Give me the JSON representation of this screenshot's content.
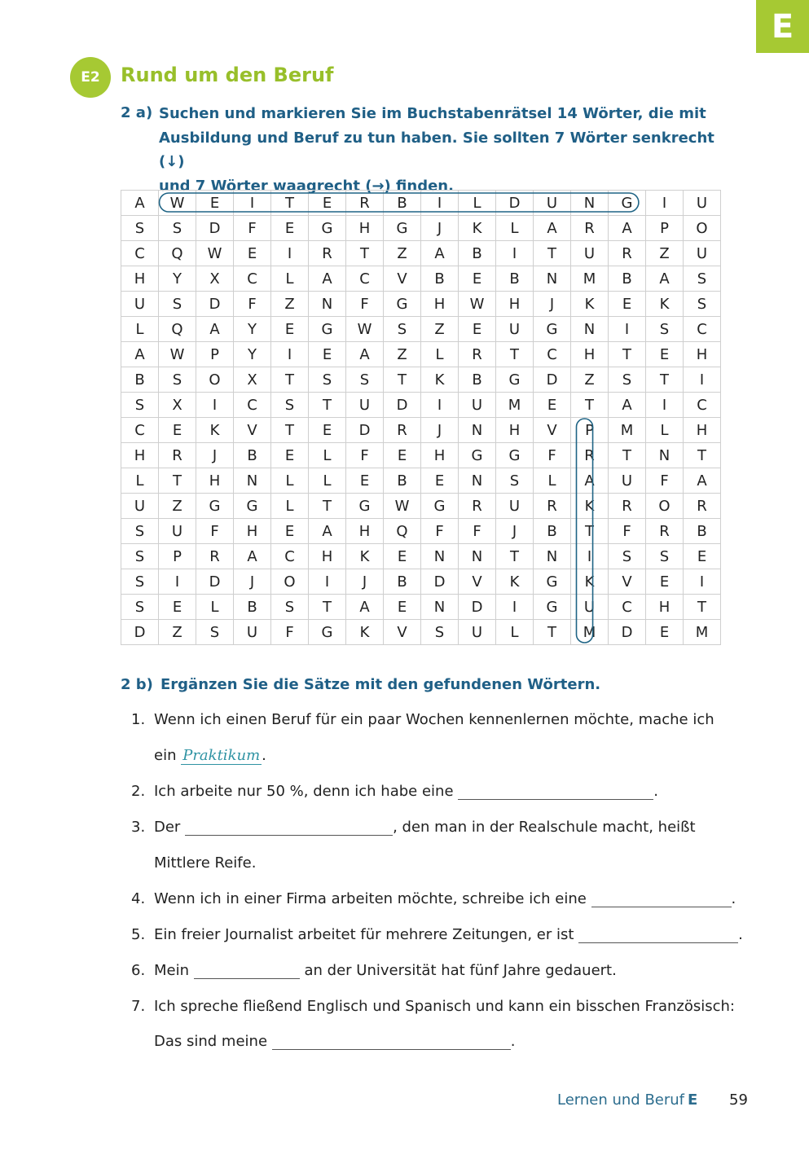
{
  "chapter_tab": "E",
  "section": {
    "badge": "E2",
    "title": "Rund um den Beruf"
  },
  "task_a": {
    "label": "2 a)",
    "lines": [
      "Suchen und markieren Sie im Buchstabenrätsel 14 Wörter, die mit",
      "Ausbildung und Beruf zu tun haben. Sie sollten 7 Wörter senkrecht (↓)",
      "und 7 Wörter waagrecht (→) finden."
    ]
  },
  "grid": {
    "rows": [
      [
        "A",
        "W",
        "E",
        "I",
        "T",
        "E",
        "R",
        "B",
        "I",
        "L",
        "D",
        "U",
        "N",
        "G",
        "I",
        "U"
      ],
      [
        "S",
        "S",
        "D",
        "F",
        "E",
        "G",
        "H",
        "G",
        "J",
        "K",
        "L",
        "A",
        "R",
        "A",
        "P",
        "O"
      ],
      [
        "C",
        "Q",
        "W",
        "E",
        "I",
        "R",
        "T",
        "Z",
        "A",
        "B",
        "I",
        "T",
        "U",
        "R",
        "Z",
        "U"
      ],
      [
        "H",
        "Y",
        "X",
        "C",
        "L",
        "A",
        "C",
        "V",
        "B",
        "E",
        "B",
        "N",
        "M",
        "B",
        "A",
        "S"
      ],
      [
        "U",
        "S",
        "D",
        "F",
        "Z",
        "N",
        "F",
        "G",
        "H",
        "W",
        "H",
        "J",
        "K",
        "E",
        "K",
        "S"
      ],
      [
        "L",
        "Q",
        "A",
        "Y",
        "E",
        "G",
        "W",
        "S",
        "Z",
        "E",
        "U",
        "G",
        "N",
        "I",
        "S",
        "C"
      ],
      [
        "A",
        "W",
        "P",
        "Y",
        "I",
        "E",
        "A",
        "Z",
        "L",
        "R",
        "T",
        "C",
        "H",
        "T",
        "E",
        "H"
      ],
      [
        "B",
        "S",
        "O",
        "X",
        "T",
        "S",
        "S",
        "T",
        "K",
        "B",
        "G",
        "D",
        "Z",
        "S",
        "T",
        "I"
      ],
      [
        "S",
        "X",
        "I",
        "C",
        "S",
        "T",
        "U",
        "D",
        "I",
        "U",
        "M",
        "E",
        "T",
        "A",
        "I",
        "C"
      ],
      [
        "C",
        "E",
        "K",
        "V",
        "T",
        "E",
        "D",
        "R",
        "J",
        "N",
        "H",
        "V",
        "P",
        "M",
        "L",
        "H"
      ],
      [
        "H",
        "R",
        "J",
        "B",
        "E",
        "L",
        "F",
        "E",
        "H",
        "G",
        "G",
        "F",
        "R",
        "T",
        "N",
        "T"
      ],
      [
        "L",
        "T",
        "H",
        "N",
        "L",
        "L",
        "E",
        "B",
        "E",
        "N",
        "S",
        "L",
        "A",
        "U",
        "F",
        "A"
      ],
      [
        "U",
        "Z",
        "G",
        "G",
        "L",
        "T",
        "G",
        "W",
        "G",
        "R",
        "U",
        "R",
        "K",
        "R",
        "O",
        "R"
      ],
      [
        "S",
        "U",
        "F",
        "H",
        "E",
        "A",
        "H",
        "Q",
        "F",
        "F",
        "J",
        "B",
        "T",
        "F",
        "R",
        "B"
      ],
      [
        "S",
        "P",
        "R",
        "A",
        "C",
        "H",
        "K",
        "E",
        "N",
        "N",
        "T",
        "N",
        "I",
        "S",
        "S",
        "E"
      ],
      [
        "S",
        "I",
        "D",
        "J",
        "O",
        "I",
        "J",
        "B",
        "D",
        "V",
        "K",
        "G",
        "K",
        "V",
        "E",
        "I"
      ],
      [
        "S",
        "E",
        "L",
        "B",
        "S",
        "T",
        "A",
        "E",
        "N",
        "D",
        "I",
        "G",
        "U",
        "C",
        "H",
        "T"
      ],
      [
        "D",
        "Z",
        "S",
        "U",
        "F",
        "G",
        "K",
        "V",
        "S",
        "U",
        "L",
        "T",
        "M",
        "D",
        "E",
        "M"
      ]
    ],
    "circled": [
      {
        "word": "WEITERBILDUNG",
        "direction": "horizontal",
        "row": 0,
        "col_start": 1,
        "col_end": 13
      },
      {
        "word": "PRAKTIKUM",
        "direction": "vertical",
        "col": 12,
        "row_start": 9,
        "row_end": 17
      }
    ],
    "circle_color": "#1f6485"
  },
  "task_b": {
    "label": "2 b)",
    "title": "Ergänzen Sie die Sätze mit den gefundenen Wörtern.",
    "items": [
      {
        "num": "1.",
        "before": "Wenn ich einen Beruf für ein paar Wochen kennenlernen möchte, mache ich",
        "line2_before": "ein",
        "answer": "Praktikum",
        "after": "."
      },
      {
        "num": "2.",
        "before": "Ich arbeite nur 50 %, denn ich habe eine",
        "after": "."
      },
      {
        "num": "3.",
        "before": "Der",
        "after": ", den man in der Realschule macht, heißt",
        "line2": "Mittlere Reife."
      },
      {
        "num": "4.",
        "before": "Wenn ich in einer Firma arbeiten möchte, schreibe ich eine",
        "after": "."
      },
      {
        "num": "5.",
        "before": "Ein freier Journalist arbeitet für mehrere Zeitungen, er ist",
        "after": "."
      },
      {
        "num": "6.",
        "before": "Mein",
        "after": "an der Universität hat fünf Jahre gedauert."
      },
      {
        "num": "7.",
        "before": "Ich spreche fließend Englisch und Spanisch und kann ein bisschen Französisch:",
        "line2_before": "Das sind meine",
        "after": "."
      }
    ]
  },
  "footer": {
    "text": "Lernen und Beruf",
    "letter": "E",
    "page": "59"
  }
}
